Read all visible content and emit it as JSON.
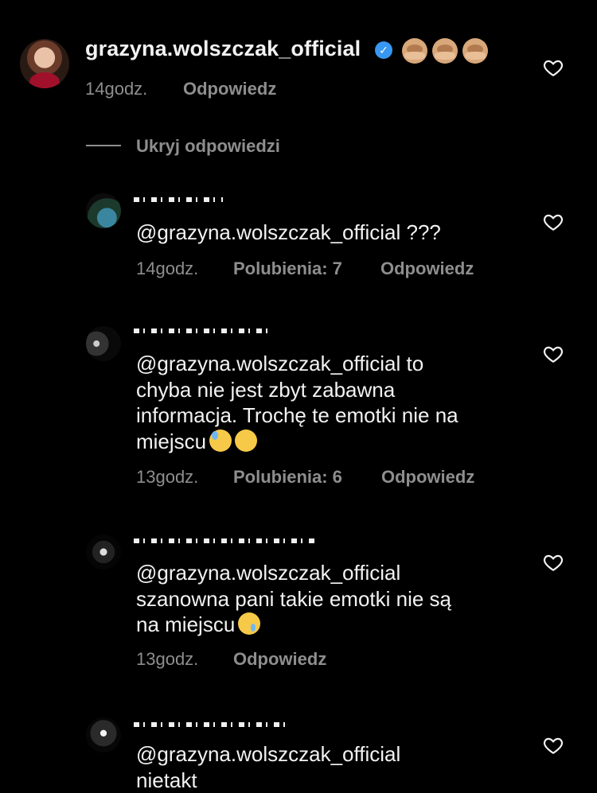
{
  "header_comment": {
    "username": "grazyna.wolszczak_official",
    "verified_mark": "✓",
    "emoji_icons": [
      "see-no-evil-monkey-icon",
      "see-no-evil-monkey-icon",
      "see-no-evil-monkey-icon"
    ],
    "time": "14godz.",
    "reply_label": "Odpowiedz"
  },
  "hide_replies_label": "Ukryj odpowiedzi",
  "replies": [
    {
      "text": "@grazyna.wolszczak_official ???",
      "time": "14godz.",
      "likes": "Polubienia: 7",
      "reply_label": "Odpowiedz"
    },
    {
      "line1": "@grazyna.wolszczak_official to",
      "line2": "chyba nie jest zbyt zabawna",
      "line3": "informacja. Trochę te emotki nie na",
      "line4": "miejscu",
      "emojis": [
        "downcast-sweat-face-icon",
        "persevering-face-icon"
      ],
      "time": "13godz.",
      "likes": "Polubienia: 6",
      "reply_label": "Odpowiedz"
    },
    {
      "line1": "@grazyna.wolszczak_official",
      "line2": "szanowna pani takie emotki nie są",
      "line3": "na miejscu",
      "emojis": [
        "crying-face-icon"
      ],
      "time": "13godz.",
      "reply_label": "Odpowiedz"
    },
    {
      "line1": "@grazyna.wolszczak_official",
      "line2": "nietakt"
    }
  ],
  "colors": {
    "background": "#000000",
    "text": "#f2f2f2",
    "muted": "#8e8e8e",
    "verified": "#3897f0"
  }
}
